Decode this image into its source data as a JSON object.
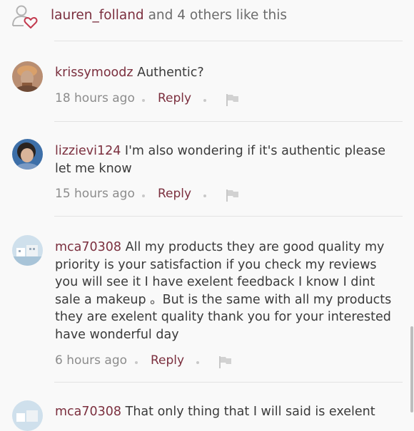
{
  "likes": {
    "user": "lauren_folland",
    "rest": " and 4 others like this"
  },
  "comments": [
    {
      "username": "krissymoodz",
      "text": " Authentic?",
      "time": "18 hours ago",
      "reply_label": "Reply"
    },
    {
      "username": "lizzievi124",
      "text": " I'm also wondering if it's authentic please let me know",
      "time": "15 hours ago",
      "reply_label": "Reply"
    },
    {
      "username": "mca70308",
      "text": " All my products  they are good quality my priority  is your satisfaction if you check my reviews you will see it I have exelent  feedback I know I dint sale a makeup 。But is the same with  all my products  they are  exelent quality thank you  for your interested  have wonderful day",
      "time": "6 hours ago",
      "reply_label": "Reply"
    },
    {
      "username": "mca70308",
      "text": " That only thing that I will said is exelent"
    }
  ],
  "colors": {
    "accent": "#7b2f3e",
    "text": "#3a3a3a",
    "muted": "#8c8c8c",
    "background": "#f9f9f9"
  },
  "icons": {
    "likes": "user-heart-icon",
    "flag": "flag-icon"
  }
}
